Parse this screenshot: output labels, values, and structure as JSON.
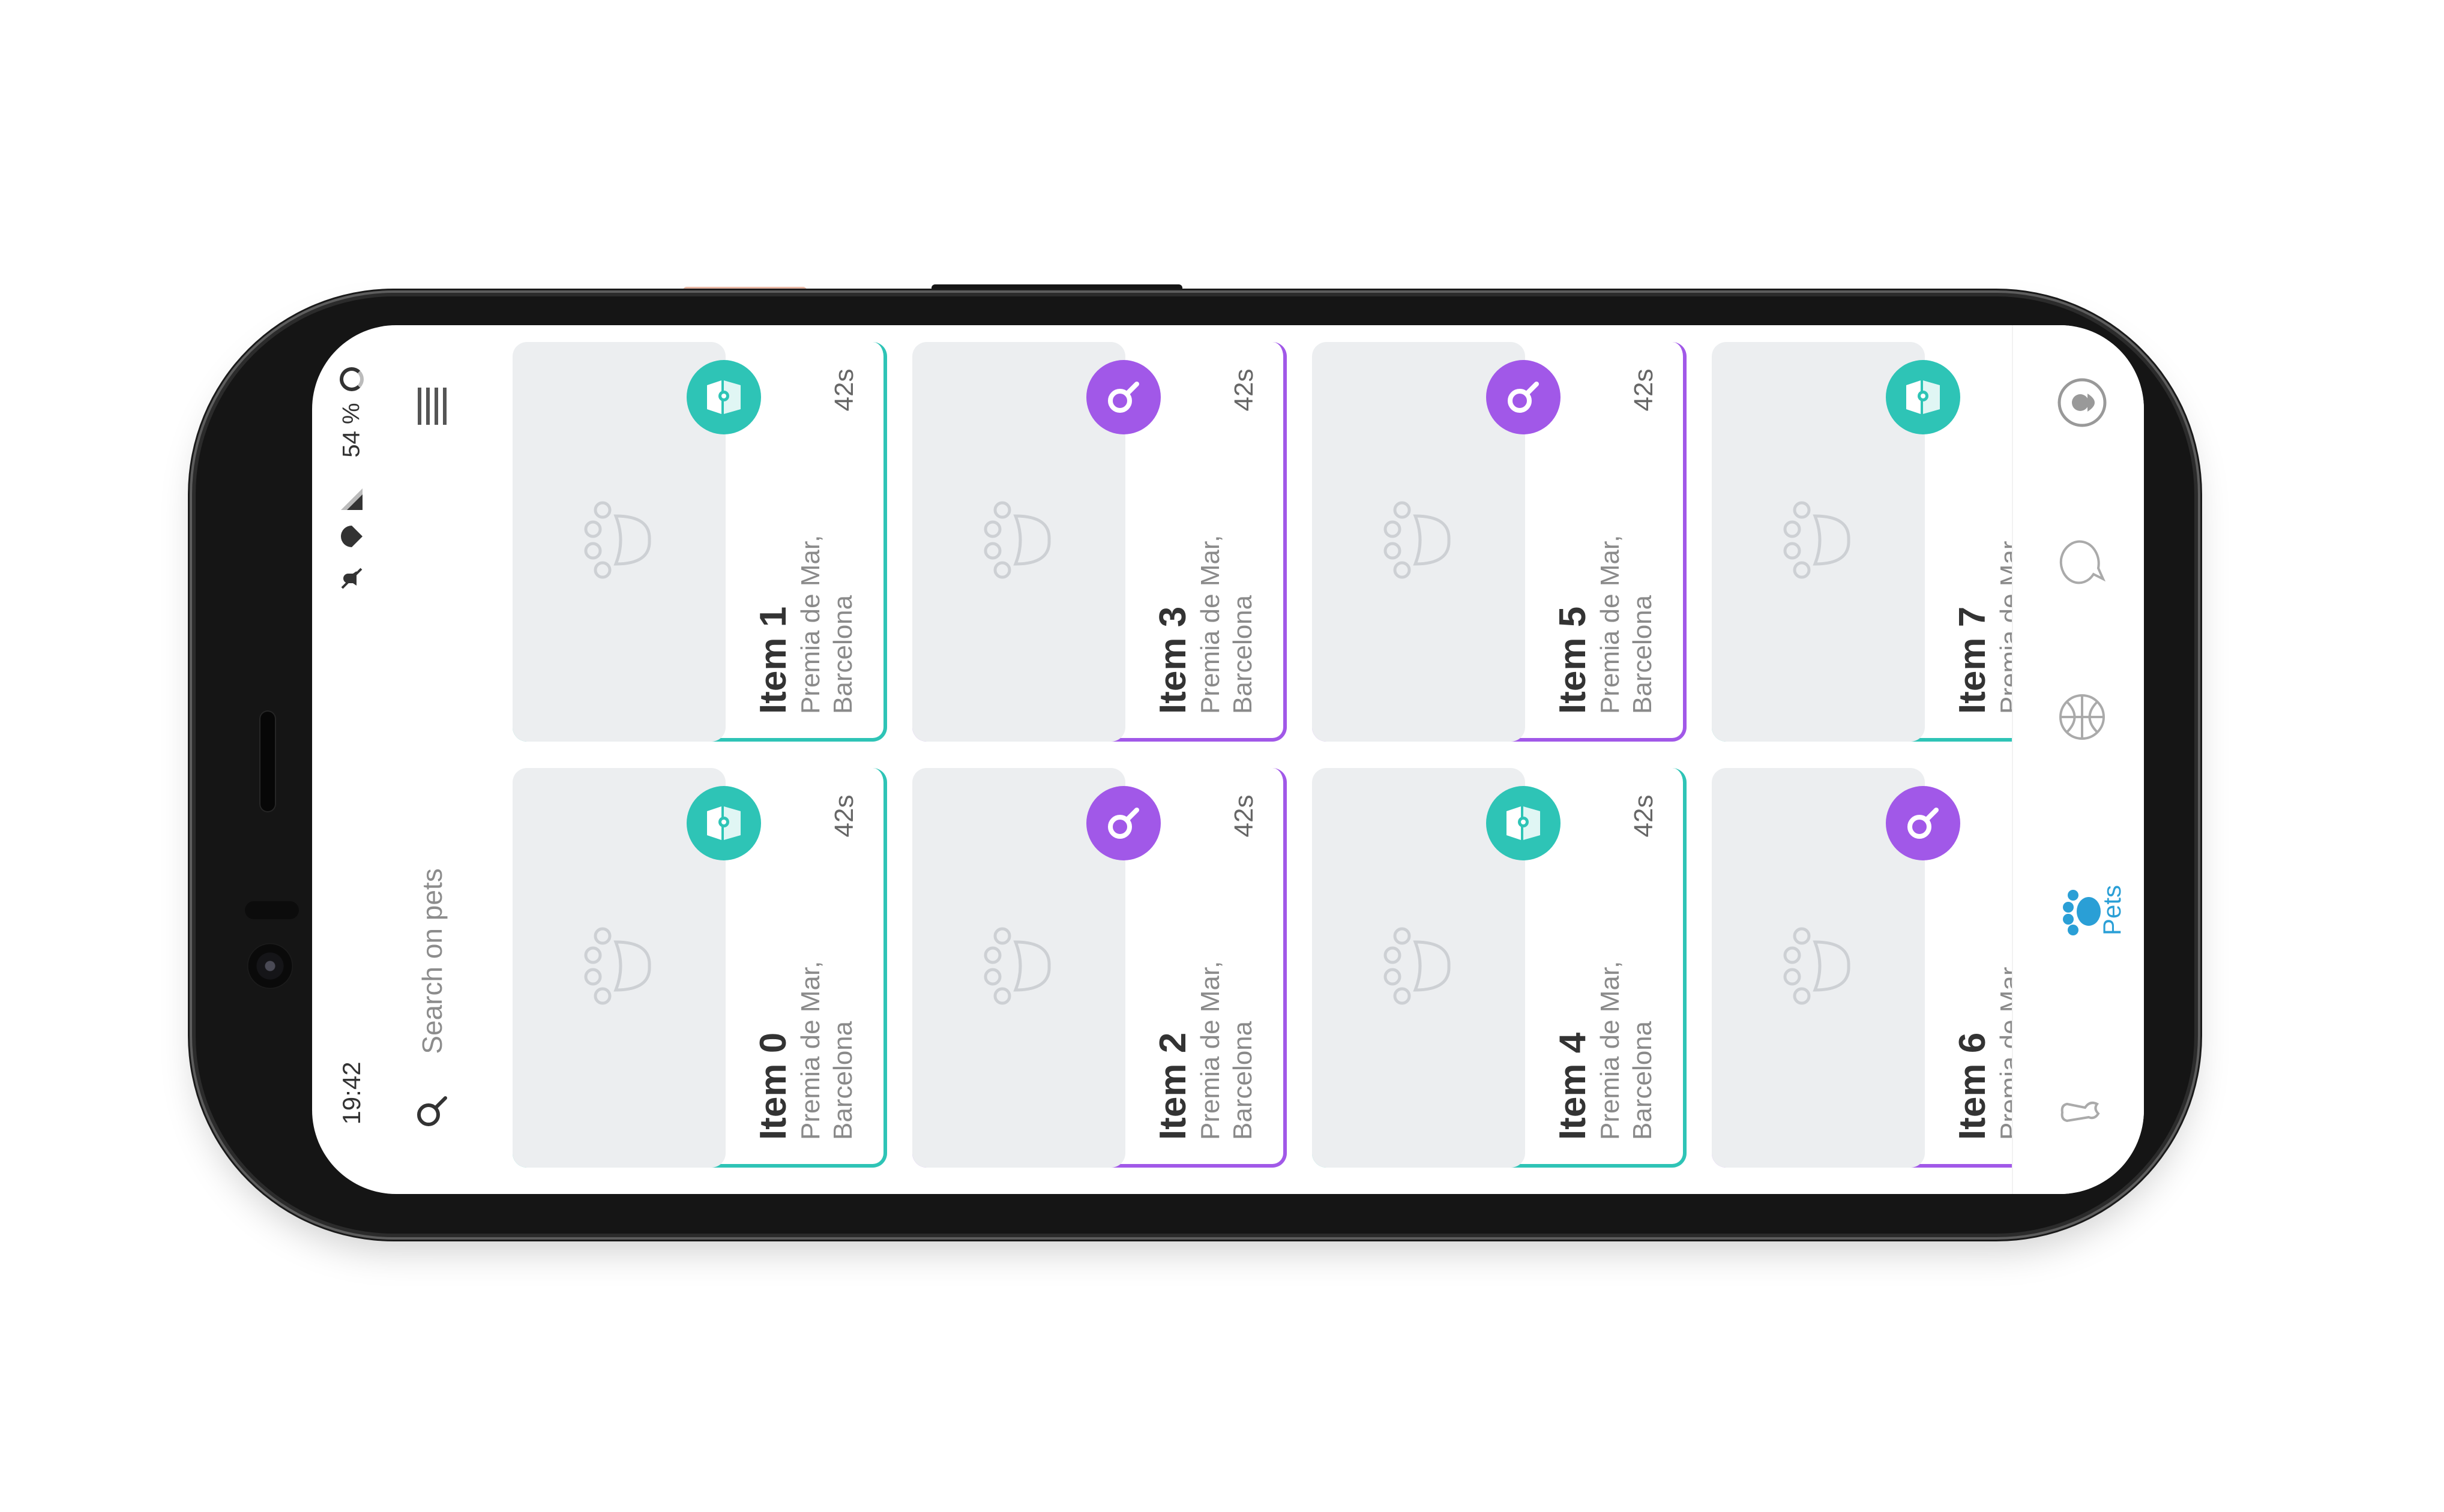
{
  "status_bar": {
    "time": "19:42",
    "battery": "54 %"
  },
  "search": {
    "placeholder": "Search on pets"
  },
  "colors": {
    "teal": "#2ec4b6",
    "purple": "#a158e8",
    "nav_active": "#2a9fd6"
  },
  "cards": [
    {
      "title": "Item 1",
      "location": "Premia de Mar, Barcelona",
      "age": "42s",
      "badge": "map-icon",
      "color": "teal"
    },
    {
      "title": "Item 3",
      "location": "Premia de Mar, Barcelona",
      "age": "42s",
      "badge": "search-icon",
      "color": "purple"
    },
    {
      "title": "Item 5",
      "location": "Premia de Mar, Barcelona",
      "age": "42s",
      "badge": "search-icon",
      "color": "purple"
    },
    {
      "title": "Item 7",
      "location": "Premia de Mar",
      "age": "",
      "badge": "map-icon",
      "color": "teal"
    },
    {
      "title": "Item 0",
      "location": "Premia de Mar, Barcelona",
      "age": "42s",
      "badge": "map-icon",
      "color": "teal"
    },
    {
      "title": "Item 2",
      "location": "Premia de Mar, Barcelona",
      "age": "42s",
      "badge": "search-icon",
      "color": "purple"
    },
    {
      "title": "Item 4",
      "location": "Premia de Mar, Barcelona",
      "age": "42s",
      "badge": "map-icon",
      "color": "teal"
    },
    {
      "title": "Item 6",
      "location": "Premia de Mar",
      "age": "",
      "badge": "search-icon",
      "color": "purple"
    }
  ],
  "nav": {
    "active_label": "Pets",
    "items": [
      "profile-icon",
      "chat-icon",
      "basketball-icon",
      "paw-icon",
      "bone-icon"
    ]
  }
}
